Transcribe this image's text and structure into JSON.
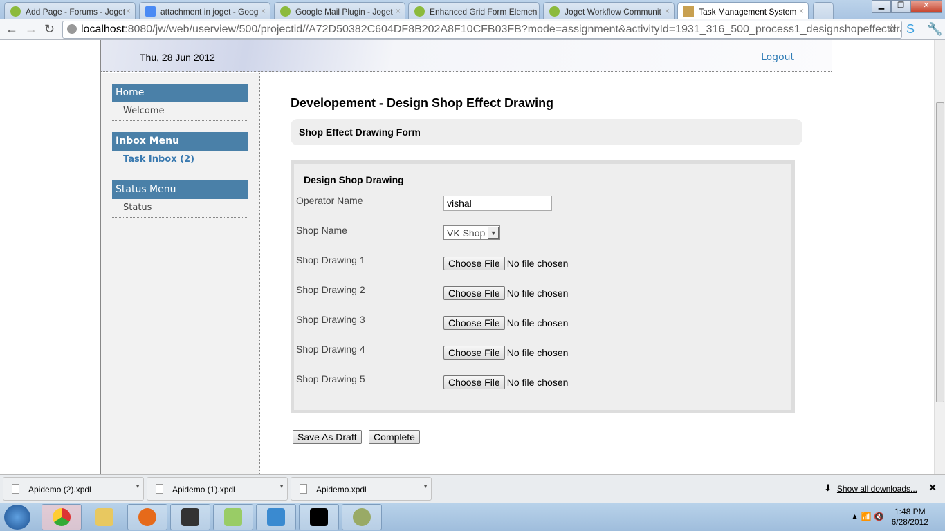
{
  "browser": {
    "tabs": [
      {
        "title": "Add Page - Forums - Joget"
      },
      {
        "title": "attachment in joget - Goog"
      },
      {
        "title": "Google Mail Plugin - Joget"
      },
      {
        "title": "Enhanced Grid Form Elemen"
      },
      {
        "title": "Joget Workflow Communit"
      },
      {
        "title": "Task Management System",
        "active": true
      }
    ],
    "url_host": "localhost",
    "url_rest": ":8080/jw/web/userview/500/projectid//A72D50382C604DF8B202A8F10CFB03FB?mode=assignment&activityId=1931_316_500_process1_designshopeffectdrawing"
  },
  "header": {
    "date": "Thu, 28 Jun 2012",
    "logout": "Logout"
  },
  "sidebar": [
    {
      "category": "Home",
      "items": [
        "Welcome"
      ]
    },
    {
      "category": "Inbox Menu",
      "items": [
        "Task Inbox (2)"
      ]
    },
    {
      "category": "Status Menu",
      "items": [
        "Status"
      ]
    }
  ],
  "main": {
    "title": "Developement - Design Shop Effect Drawing",
    "form_title": "Shop Effect Drawing Form",
    "section_title": "Design Shop Drawing",
    "fields": {
      "operator_label": "Operator Name",
      "operator_value": "vishal",
      "shop_label": "Shop Name",
      "shop_value": "VK Shop",
      "drawings": [
        "Shop Drawing 1",
        "Shop Drawing 2",
        "Shop Drawing 3",
        "Shop Drawing 4",
        "Shop Drawing 5"
      ],
      "choose_file": "Choose File",
      "no_file": "No file chosen"
    },
    "save_draft": "Save As Draft",
    "complete": "Complete"
  },
  "downloads": {
    "items": [
      "Apidemo (2).xpdl",
      "Apidemo (1).xpdl",
      "Apidemo.xpdl"
    ],
    "show_all": "Show all downloads..."
  },
  "taskbar": {
    "time": "1:48 PM",
    "date": "6/28/2012"
  }
}
